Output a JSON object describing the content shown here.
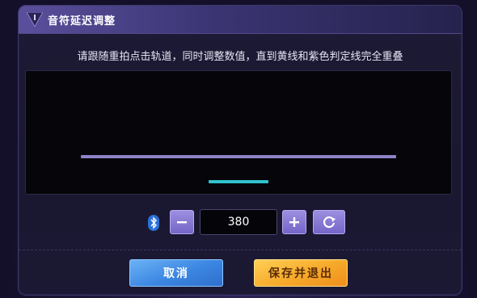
{
  "dialog": {
    "title": "音符延迟调整",
    "instruction": "请跟随重拍点击轨道，同时调整数值，直到黄线和紫色判定线完全重叠"
  },
  "controls": {
    "delay_value": "380",
    "bluetooth_icon": "bluetooth-icon",
    "minus_icon": "minus-icon",
    "plus_icon": "plus-icon",
    "reset_icon": "refresh-icon"
  },
  "footer": {
    "cancel_label": "取消",
    "save_label": "保存并退出"
  },
  "colors": {
    "judge_line": "#8e83c8",
    "note_line": "#2fc4cd",
    "accent_button": "#7565c8",
    "cancel": "#3b86e2",
    "save": "#f6a92a"
  }
}
